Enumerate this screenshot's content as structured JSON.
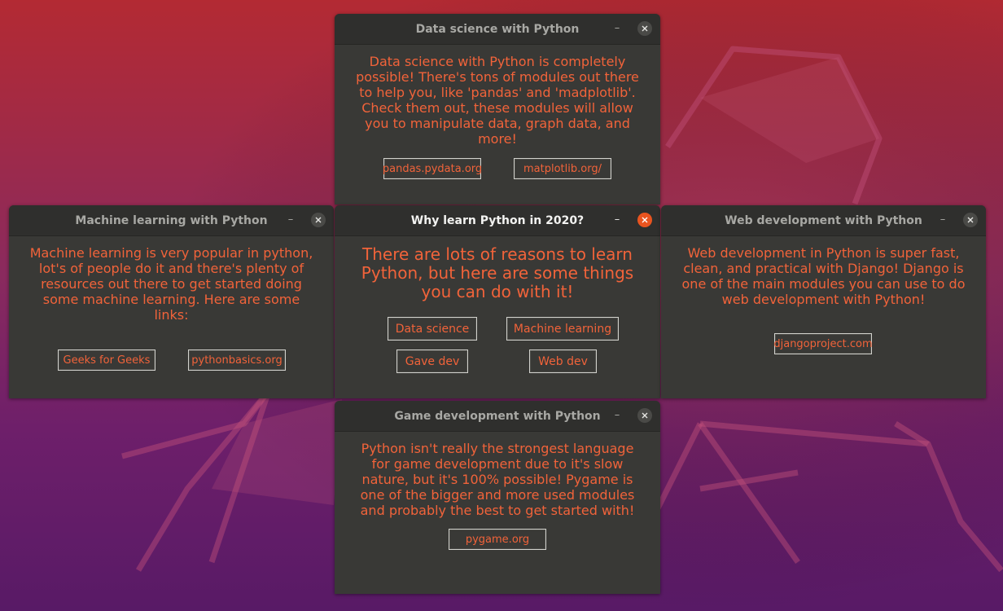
{
  "windows": {
    "data_science": {
      "title": "Data science with Python",
      "text": "Data science with Python is completely\npossible! There's tons of modules out there\nto help you, like 'pandas' and 'madplotlib'.\nCheck them out, these modules will allow\nyou to manipulate data, graph data, and\nmore!",
      "buttons": [
        "pandas.pydata.org",
        "matplotlib.org/"
      ]
    },
    "machine_learning": {
      "title": "Machine learning with Python",
      "text": "Machine learning is very popular in python,\nlot's of people do it and there's plenty of\nresources out there to get started doing\nsome machine learning. Here are some\nlinks:",
      "buttons": [
        "Geeks for Geeks",
        "pythonbasics.org"
      ]
    },
    "main": {
      "title": "Why learn Python in 2020?",
      "text": "There are lots of reasons to learn\nPython, but here are some things\nyou can do with it!",
      "buttons": [
        "Data science",
        "Machine learning",
        "Gave dev",
        "Web dev"
      ]
    },
    "web_development": {
      "title": "Web development with Python",
      "text": "Web development in Python is super fast,\nclean, and practical with Django! Django is\none of the main modules you can use to do\nweb development with Python!",
      "buttons": [
        "djangoproject.com"
      ]
    },
    "game_development": {
      "title": "Game development with Python",
      "text": "Python isn't really the strongest language\nfor game development due to it's slow\nnature, but it's 100% possible! Pygame is\none of the bigger and more used modules\nand probably the best to get started with!",
      "buttons": [
        "pygame.org"
      ]
    }
  },
  "window_controls": {
    "minimize_glyph": "–"
  },
  "colors": {
    "window_bg": "#393936",
    "titlebar_bg": "#2f2f2d",
    "text_orange": "#f1633a",
    "close_active": "#e9541f"
  },
  "icons": {
    "minimize": "minimize-icon",
    "close": "close-icon"
  }
}
